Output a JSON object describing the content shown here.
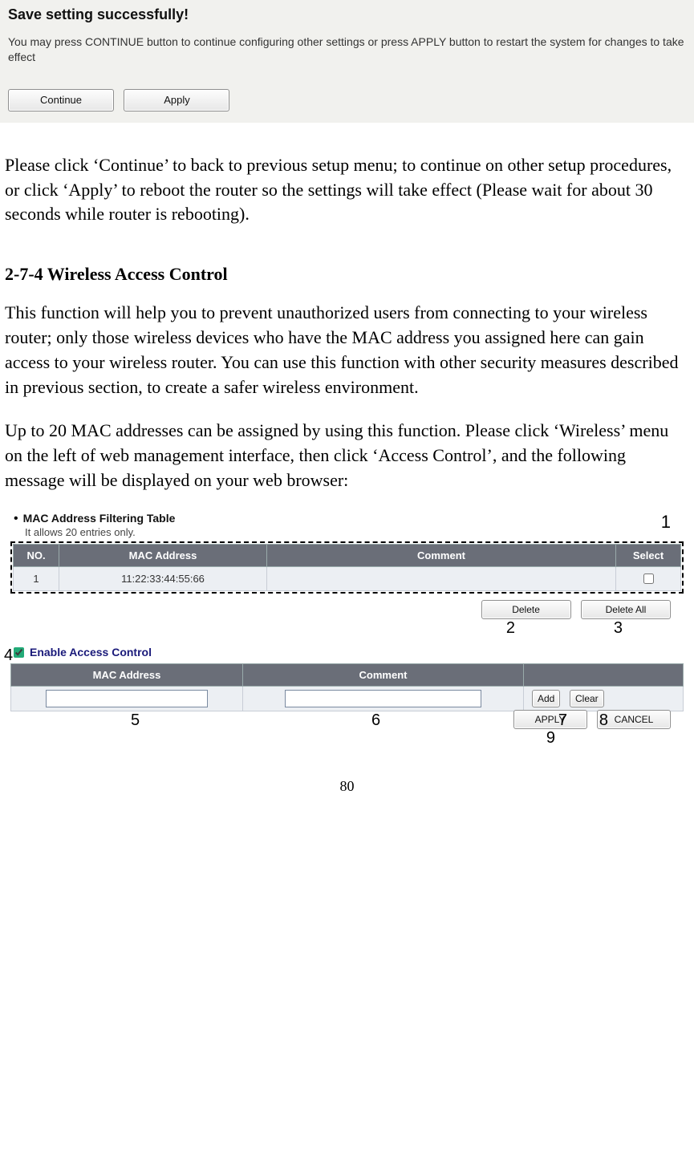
{
  "save_box": {
    "title": "Save setting successfully!",
    "text": "You may press CONTINUE button to continue configuring other settings or press APPLY button to restart the system for changes to take effect",
    "continue_label": "Continue",
    "apply_label": "Apply"
  },
  "para1": "Please click ‘Continue’ to back to previous setup menu; to continue on other setup procedures, or click ‘Apply’ to reboot the router so the settings will take effect (Please wait for about 30 seconds while router is rebooting).",
  "heading": "2-7-4 Wireless Access Control",
  "para2": "This function will help you to prevent unauthorized users from connecting to your wireless router; only those wireless devices who have the MAC address you assigned here can gain access to your wireless router. You can use this function with other security measures described in previous section, to create a safer wireless environment.",
  "para3": "Up to 20 MAC addresses can be assigned by using this function. Please click ‘Wireless’ menu on the left of web management interface, then click ‘Access Control’, and the following message will be displayed on your web browser:",
  "router": {
    "filter_title": "MAC Address Filtering Table",
    "filter_note": "It allows 20 entries only.",
    "headers": {
      "no": "NO.",
      "mac": "MAC Address",
      "comment": "Comment",
      "select": "Select"
    },
    "row1": {
      "no": "1",
      "mac": "11:22:33:44:55:66",
      "comment": "",
      "select": false
    },
    "delete_label": "Delete",
    "delete_all_label": "Delete All",
    "enable_label": "Enable Access Control",
    "add_headers": {
      "mac": "MAC Address",
      "comment": "Comment"
    },
    "add_label": "Add",
    "clear_label": "Clear",
    "apply_label": "APPLY",
    "cancel_label": "CANCEL"
  },
  "callouts": {
    "c1": "1",
    "c2": "2",
    "c3": "3",
    "c4": "4",
    "c5": "5",
    "c6": "6",
    "c7": "7",
    "c8": "8",
    "c9": "9"
  },
  "page_number": "80"
}
